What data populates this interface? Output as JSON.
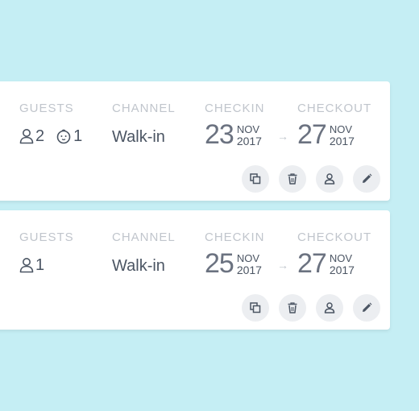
{
  "reservations": [
    {
      "guests_label": "GUESTS",
      "channel_label": "CHANNEL",
      "checkin_label": "CHECKIN",
      "checkout_label": "CHECKOUT",
      "adults": "2",
      "children": "1",
      "channel": "Walk-in",
      "checkin": {
        "day": "23",
        "month": "NOV",
        "year": "2017"
      },
      "checkout": {
        "day": "27",
        "month": "NOV",
        "year": "2017"
      },
      "arrow": "→"
    },
    {
      "guests_label": "GUESTS",
      "channel_label": "CHANNEL",
      "checkin_label": "CHECKIN",
      "checkout_label": "CHECKOUT",
      "adults": "1",
      "channel": "Walk-in",
      "checkin": {
        "day": "25",
        "month": "NOV",
        "year": "2017"
      },
      "checkout": {
        "day": "27",
        "month": "NOV",
        "year": "2017"
      },
      "arrow": "→"
    }
  ],
  "actions": [
    {
      "icon": "copy-icon"
    },
    {
      "icon": "trash-icon"
    },
    {
      "icon": "person-icon"
    },
    {
      "icon": "pencil-icon"
    }
  ],
  "colors": {
    "background": "#c5eef4",
    "card": "#ffffff",
    "label": "#c0c5cc",
    "text": "#4b5563",
    "action_bg": "#eceef1"
  }
}
